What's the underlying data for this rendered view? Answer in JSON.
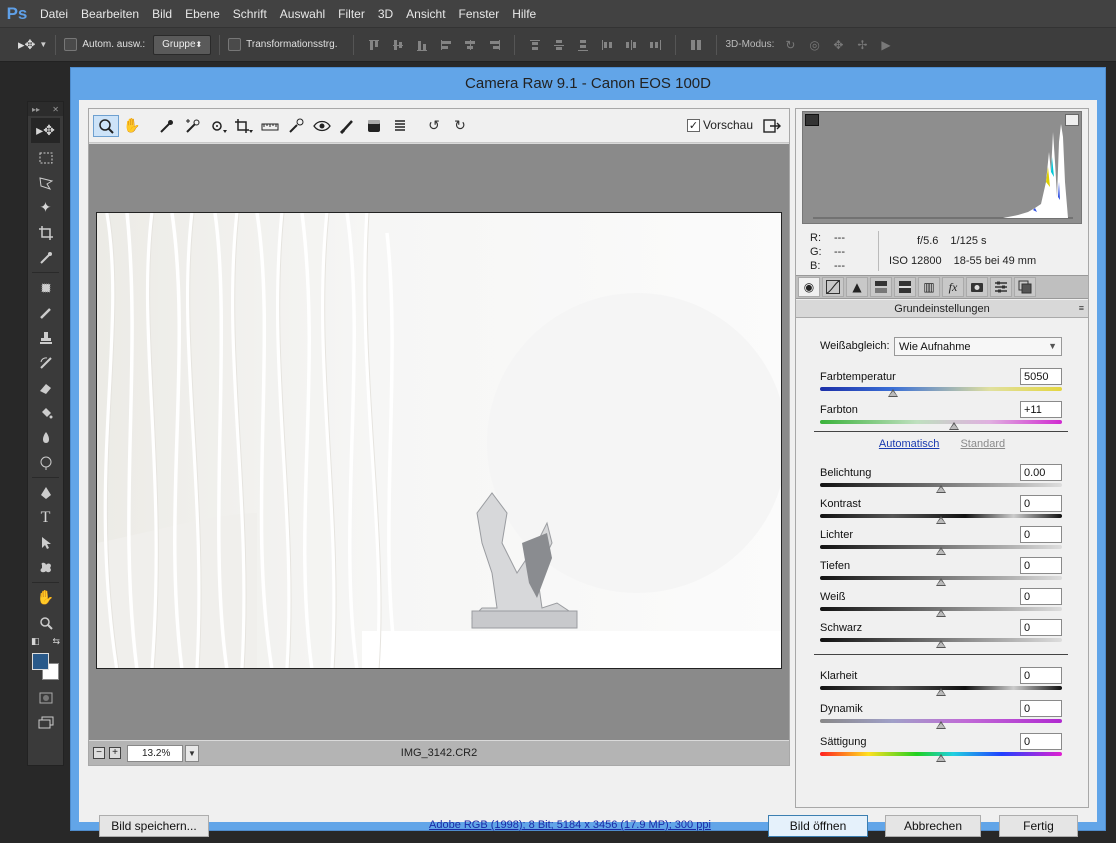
{
  "ps": {
    "logo": "Ps",
    "menu": [
      "Datei",
      "Bearbeiten",
      "Bild",
      "Ebene",
      "Schrift",
      "Auswahl",
      "Filter",
      "3D",
      "Ansicht",
      "Fenster",
      "Hilfe"
    ],
    "options": {
      "auto_select_label": "Autom. ausw.:",
      "group_value": "Gruppe",
      "transform_label": "Transformationsstrg.",
      "mode_3d_label": "3D-Modus:"
    }
  },
  "dialog": {
    "title": "Camera Raw 9.1 - Canon EOS 100D",
    "preview_label": "Vorschau",
    "zoom_value": "13.2%",
    "filename": "IMG_3142.CR2",
    "readouts": {
      "r_label": "R:",
      "r_value": "---",
      "g_label": "G:",
      "g_value": "---",
      "b_label": "B:",
      "b_value": "---",
      "aperture": "f/5.6",
      "shutter": "1/125 s",
      "iso": "ISO 12800",
      "lens": "18-55 bei 49 mm"
    },
    "panel_title": "Grundeinstellungen",
    "white_balance": {
      "label": "Weißabgleich:",
      "value": "Wie Aufnahme"
    },
    "temperature": {
      "label": "Farbtemperatur",
      "value": "5050",
      "position": 0.3
    },
    "tint": {
      "label": "Farbton",
      "value": "+11",
      "position": 0.555
    },
    "auto_link": "Automatisch",
    "default_link": "Standard",
    "sliders": [
      {
        "label": "Belichtung",
        "value": "0.00",
        "position": 0.5
      },
      {
        "label": "Kontrast",
        "value": "0",
        "position": 0.5
      },
      {
        "label": "Lichter",
        "value": "0",
        "position": 0.5
      },
      {
        "label": "Tiefen",
        "value": "0",
        "position": 0.5
      },
      {
        "label": "Weiß",
        "value": "0",
        "position": 0.5
      },
      {
        "label": "Schwarz",
        "value": "0",
        "position": 0.5
      }
    ],
    "presence": [
      {
        "label": "Klarheit",
        "value": "0",
        "position": 0.5
      },
      {
        "label": "Dynamik",
        "value": "0",
        "position": 0.5
      },
      {
        "label": "Sättigung",
        "value": "0",
        "position": 0.5
      }
    ],
    "bottom": {
      "save_button": "Bild speichern...",
      "workflow_link": "Adobe RGB (1998); 8 Bit; 5184 x 3456 (17.9 MP); 300 ppi",
      "open_button": "Bild öffnen",
      "cancel_button": "Abbrechen",
      "done_button": "Fertig"
    }
  },
  "colors": {
    "dialog_frame": "#62a5e8",
    "foreground_color": "#2a5a8a",
    "background_color": "#ffffff",
    "link_color": "#1a2aa6"
  }
}
